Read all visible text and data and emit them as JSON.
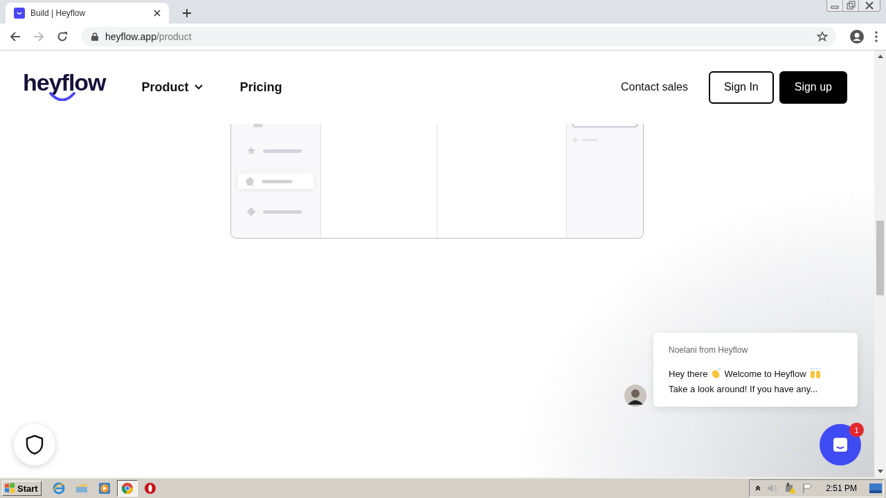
{
  "browser": {
    "tab": {
      "title": "Build | Heyflow",
      "selected": true
    },
    "address": {
      "host": "heyflow.app",
      "path": "/product"
    }
  },
  "header": {
    "logo": "heyflow",
    "nav": [
      {
        "label": "Product",
        "has_menu": true
      },
      {
        "label": "Pricing",
        "has_menu": false
      }
    ],
    "contact": "Contact sales",
    "buttons": [
      {
        "label": "Sign In",
        "kind": "outline"
      },
      {
        "label": "Sign up",
        "kind": "filled"
      }
    ]
  },
  "chat": {
    "sender": "Noelani from Heyflow",
    "greeting": "Hey there",
    "welcome": "Welcome to Heyflow",
    "preview": "Take a look around! If you have any...",
    "badge": "1"
  },
  "taskbar": {
    "start": "Start",
    "time": "2:51 PM"
  }
}
